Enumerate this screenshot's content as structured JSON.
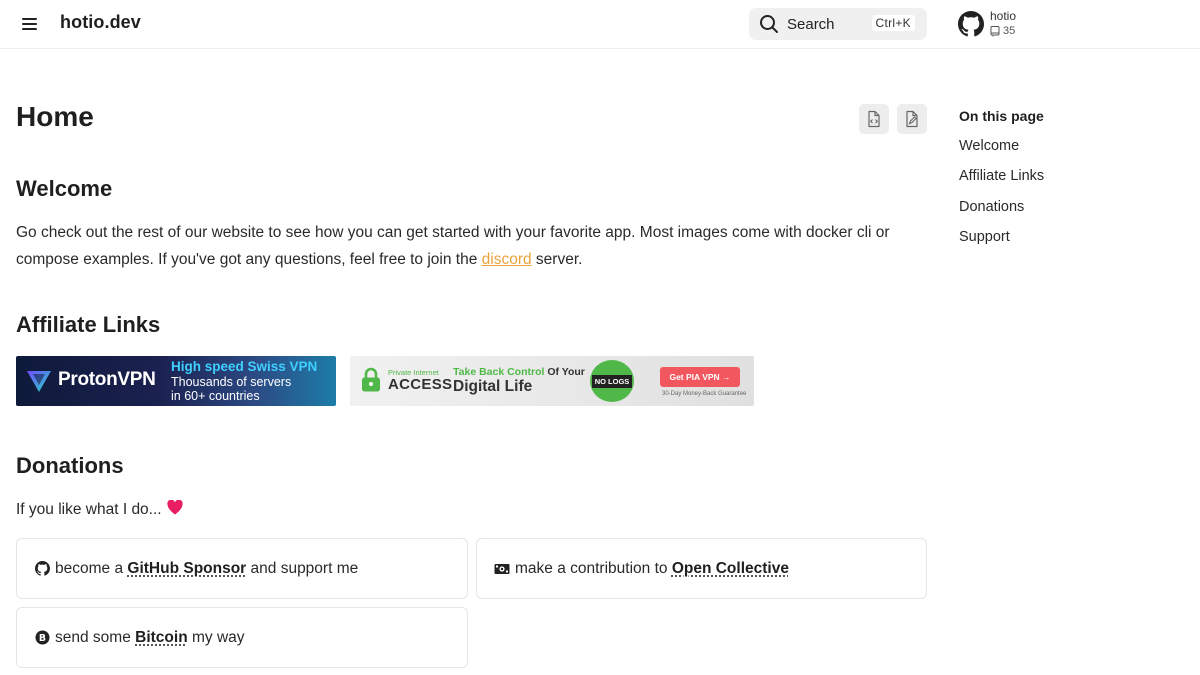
{
  "header": {
    "site_title": "hotio.dev",
    "search_label": "Search",
    "search_shortcut": "Ctrl+K",
    "repo_name": "hotio",
    "repo_count": "35"
  },
  "main": {
    "page_title": "Home",
    "welcome": {
      "heading": "Welcome",
      "text_before_link": "Go check out the rest of our website to see how you can get started with your favorite app. Most images come with docker cli or compose examples. If you've got any questions, feel free to join the ",
      "link_text": "discord",
      "text_after_link": " server."
    },
    "affiliate": {
      "heading": "Affiliate Links",
      "proton": {
        "brand": "ProtonVPN",
        "line1": "High speed Swiss VPN",
        "line2": "Thousands of servers",
        "line3": "in 60+ countries"
      },
      "pia": {
        "brand_small": "Private Internet",
        "brand_big": "ACCESS",
        "tag_colored": "Take Back Control",
        "tag_rest": " Of Your",
        "tag_line2": "Digital Life",
        "badge": "NO LOGS",
        "cta": "Get PIA VPN →",
        "guarantee": "30-Day Money-Back Guarantee"
      }
    },
    "donations": {
      "heading": "Donations",
      "intro": "If you like what I do...",
      "cards": [
        {
          "prefix": "become a ",
          "link": "GitHub Sponsor",
          "suffix": " and support me"
        },
        {
          "prefix": "make a contribution to ",
          "link": "Open Collective",
          "suffix": ""
        },
        {
          "prefix": "send some ",
          "link": "Bitcoin",
          "suffix": " my way"
        }
      ]
    }
  },
  "toc": {
    "title": "On this page",
    "items": [
      "Welcome",
      "Affiliate Links",
      "Donations",
      "Support"
    ]
  },
  "colors": {
    "link_accent": "#e8a33c",
    "heart": "#e91e63",
    "pia_cta": "#f2565f",
    "pia_green": "#4fb848"
  }
}
